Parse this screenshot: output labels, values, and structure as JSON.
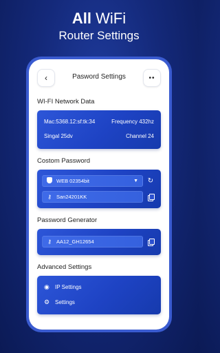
{
  "promo": {
    "line1_bold": "All",
    "line1_rest": " WiFi",
    "line2": "Router Settings"
  },
  "screen": {
    "title": "Pasword Settings",
    "back_icon": "chevron-left-icon",
    "more_icon": "more-dots-icon"
  },
  "network_data": {
    "label": "WI-FI Network Data",
    "mac": "Mac:5368.12:sf:tk:34",
    "frequency": "Frequency 432hz",
    "signal": "Singal 25dv",
    "channel": "Channel 24"
  },
  "custom_password": {
    "label": "Costom Password",
    "network_value": "WEB 02354bit",
    "password_value": "San24201KK"
  },
  "generator": {
    "label": "Password Generator",
    "value": "AA12_GH12654"
  },
  "advanced": {
    "label": "Advanced Settings",
    "items": [
      {
        "label": "IP Settings",
        "icon": "wifi-signal-icon"
      },
      {
        "label": "Settings",
        "icon": "gear-icon"
      }
    ]
  },
  "colors": {
    "accent": "#1f46c8",
    "background": "#14297a"
  }
}
